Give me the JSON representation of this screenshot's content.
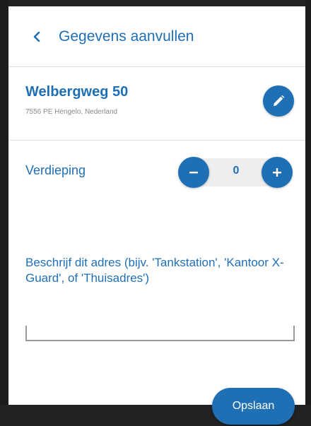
{
  "colors": {
    "accent": "#1f6fb5",
    "muted_text": "#8a8a8a",
    "frame": "#222222"
  },
  "header": {
    "back_icon": "chevron-left-icon",
    "title": "Gegevens aanvullen"
  },
  "address": {
    "street": "Welbergweg 50",
    "city": "7556 PE Hengelo, Nederland",
    "edit_icon": "pencil-icon"
  },
  "floor": {
    "label": "Verdieping",
    "value": "0",
    "minus_icon": "minus-icon",
    "plus_icon": "plus-icon"
  },
  "description": {
    "label": "Beschrijf dit adres (bijv. 'Tankstation', 'Kantoor X-Guard', of 'Thuisadres')",
    "value": "",
    "placeholder": ""
  },
  "actions": {
    "save_label": "Opslaan"
  }
}
